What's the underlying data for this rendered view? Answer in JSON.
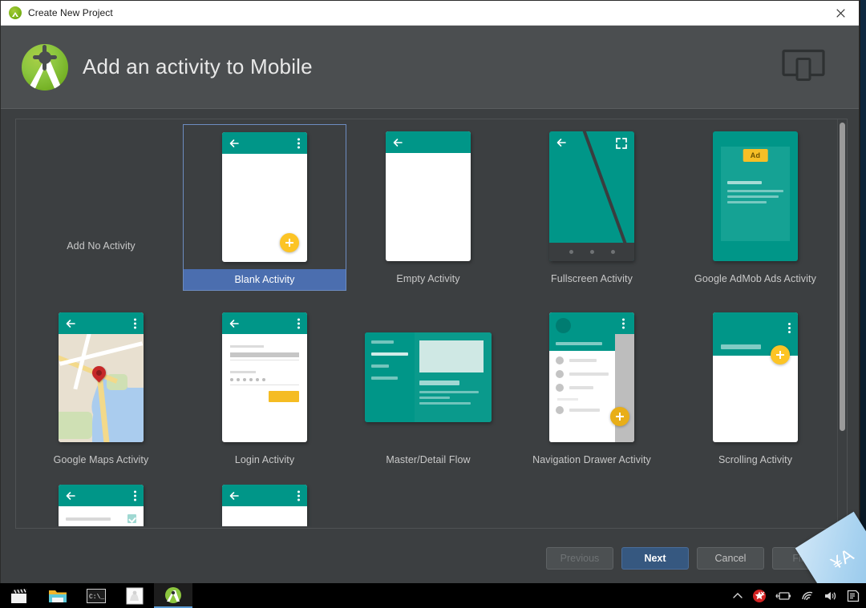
{
  "window": {
    "title": "Create New Project",
    "title_icon": "android-studio-icon",
    "close_label": "✕"
  },
  "header": {
    "title": "Add an activity to Mobile",
    "logo": "android-studio-logo",
    "device_icon": "tablet-device-icon"
  },
  "gallery": {
    "items": [
      {
        "label": "Add No Activity",
        "thumb": "none",
        "selected": false
      },
      {
        "label": "Blank Activity",
        "thumb": "blank",
        "selected": true
      },
      {
        "label": "Empty Activity",
        "thumb": "empty",
        "selected": false
      },
      {
        "label": "Fullscreen Activity",
        "thumb": "fullscreen",
        "selected": false
      },
      {
        "label": "Google AdMob Ads Activity",
        "thumb": "admob",
        "selected": false
      },
      {
        "label": "Google Maps Activity",
        "thumb": "maps",
        "selected": false
      },
      {
        "label": "Login Activity",
        "thumb": "login",
        "selected": false
      },
      {
        "label": "Master/Detail Flow",
        "thumb": "masterdetail",
        "selected": false
      },
      {
        "label": "Navigation Drawer Activity",
        "thumb": "navdrawer",
        "selected": false
      },
      {
        "label": "Scrolling Activity",
        "thumb": "scrolling",
        "selected": false
      },
      {
        "label": "",
        "thumb": "settings-partial",
        "selected": false
      },
      {
        "label": "",
        "thumb": "tabbed-partial",
        "selected": false
      }
    ],
    "admob_badge": "Ad",
    "scrollbar": "vertical-scrollbar"
  },
  "footer": {
    "previous": "Previous",
    "next": "Next",
    "cancel": "Cancel",
    "finish": "Finish"
  },
  "colors": {
    "material_teal": "#009688",
    "accent_amber": "#fcc425",
    "selection_blue": "#4b6eaf",
    "primary_button": "#365880",
    "dialog_bg": "#3c3f41",
    "header_bg": "#4b4e50"
  },
  "taskbar": {
    "apps": [
      {
        "name": "media-player-icon"
      },
      {
        "name": "file-explorer-icon"
      },
      {
        "name": "terminal-icon"
      },
      {
        "name": "image-viewer-icon"
      },
      {
        "name": "android-studio-taskbar-icon"
      }
    ],
    "tray": [
      {
        "name": "show-hidden-icons-chevron"
      },
      {
        "name": "antivirus-icon"
      },
      {
        "name": "battery-icon"
      },
      {
        "name": "wifi-icon"
      },
      {
        "name": "volume-icon"
      },
      {
        "name": "notifications-icon"
      }
    ]
  }
}
